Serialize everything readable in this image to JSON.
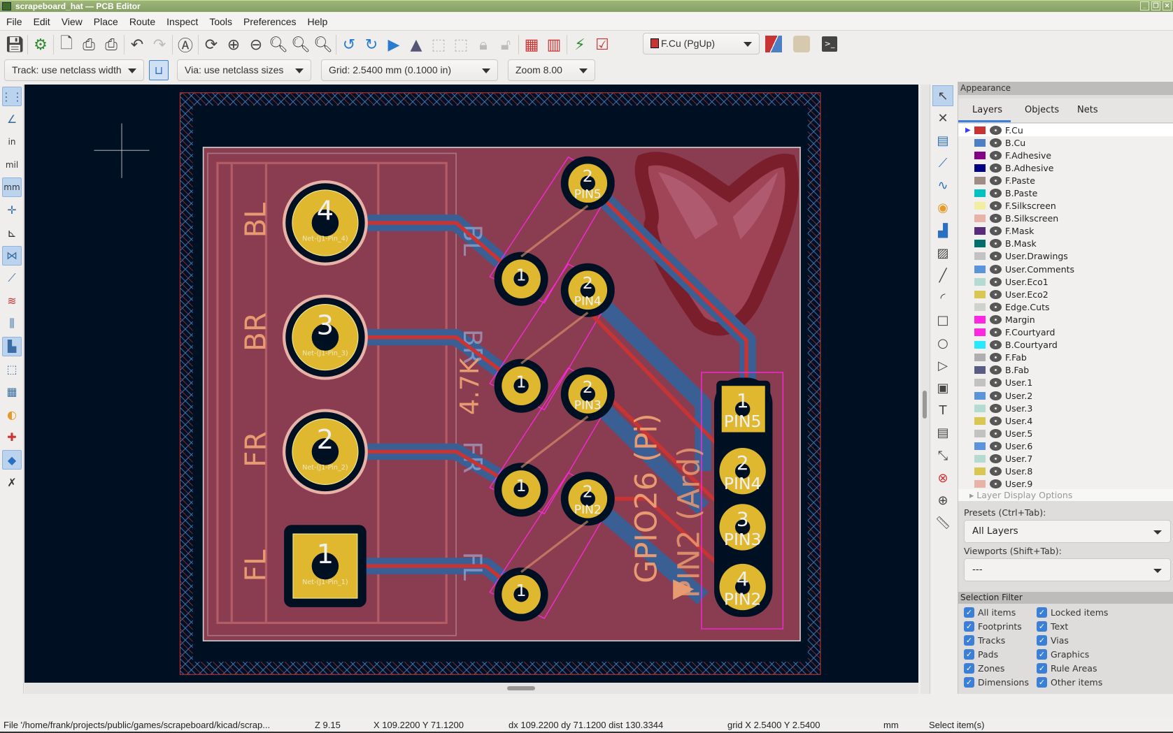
{
  "window": {
    "title": "scrapeboard_hat — PCB Editor",
    "controls": [
      "minimize",
      "restore",
      "close"
    ]
  },
  "menu": [
    "File",
    "Edit",
    "View",
    "Place",
    "Route",
    "Inspect",
    "Tools",
    "Preferences",
    "Help"
  ],
  "toolbar": {
    "layer_select": "F.Cu (PgUp)",
    "layer_color": "#c83434",
    "track_width": "Track: use netclass width",
    "via_size": "Via: use netclass sizes",
    "grid": "Grid: 2.5400 mm (0.1000 in)",
    "zoom": "Zoom 8.00"
  },
  "left_toolbar": {
    "units": {
      "in": "in",
      "mil": "mil",
      "mm": "mm"
    }
  },
  "board": {
    "large_pads": [
      {
        "num": "4",
        "net": "Net-(J1-Pin_4)"
      },
      {
        "num": "3",
        "net": "Net-(J1-Pin_3)"
      },
      {
        "num": "2",
        "net": "Net-(J1-Pin_2)"
      },
      {
        "num": "1",
        "net": "Net-(J1-Pin_1)"
      }
    ],
    "pad_labels": [
      "BL",
      "BR",
      "FR",
      "FL"
    ],
    "back_labels": [
      "BL",
      "BR",
      "FR",
      "FL"
    ],
    "resistor_value": "4.7K",
    "resistor_pins": [
      {
        "p1": "1",
        "p2": "2",
        "name": "PIN5"
      },
      {
        "p1": "1",
        "p2": "2",
        "name": "PIN4"
      },
      {
        "p1": "1",
        "p2": "2",
        "name": "PIN3"
      },
      {
        "p1": "1",
        "p2": "2",
        "name": "PIN2"
      }
    ],
    "connector_pins": [
      {
        "num": "1",
        "name": "PIN5"
      },
      {
        "num": "2",
        "name": "PIN4"
      },
      {
        "num": "3",
        "name": "PIN3"
      },
      {
        "num": "4",
        "name": "PIN2"
      }
    ],
    "silk_gpio": "GPIO26 (Pi)",
    "silk_ard": "PIN2 (Ard)",
    "colors": {
      "background": "#001023",
      "board": "#8a3d51",
      "front_copper": "#c83434",
      "back_copper": "#3a5f94",
      "pad": "#e0b830",
      "silkscreen": "#e89a70",
      "courtyard": "#ff26e2"
    }
  },
  "appearance": {
    "title": "Appearance",
    "tabs": [
      "Layers",
      "Objects",
      "Nets"
    ],
    "active_tab": "Layers",
    "layers": [
      {
        "name": "F.Cu",
        "color": "#c83434"
      },
      {
        "name": "B.Cu",
        "color": "#4d7fc4"
      },
      {
        "name": "F.Adhesive",
        "color": "#840084"
      },
      {
        "name": "B.Adhesive",
        "color": "#000084"
      },
      {
        "name": "F.Paste",
        "color": "#a08c86"
      },
      {
        "name": "B.Paste",
        "color": "#00c2c2"
      },
      {
        "name": "F.Silkscreen",
        "color": "#f2eda1"
      },
      {
        "name": "B.Silkscreen",
        "color": "#e8b2a7"
      },
      {
        "name": "F.Mask",
        "color": "#582c7a"
      },
      {
        "name": "B.Mask",
        "color": "#016e6e"
      },
      {
        "name": "User.Drawings",
        "color": "#c2c2c2"
      },
      {
        "name": "User.Comments",
        "color": "#5994dc"
      },
      {
        "name": "User.Eco1",
        "color": "#b4dbd2"
      },
      {
        "name": "User.Eco2",
        "color": "#d8c852"
      },
      {
        "name": "Edge.Cuts",
        "color": "#d0d2cd"
      },
      {
        "name": "Margin",
        "color": "#ff26e2"
      },
      {
        "name": "F.Courtyard",
        "color": "#ff26e2"
      },
      {
        "name": "B.Courtyard",
        "color": "#26e9ff"
      },
      {
        "name": "F.Fab",
        "color": "#afafaf"
      },
      {
        "name": "B.Fab",
        "color": "#585d84"
      },
      {
        "name": "User.1",
        "color": "#c2c2c2"
      },
      {
        "name": "User.2",
        "color": "#5994dc"
      },
      {
        "name": "User.3",
        "color": "#b4dbd2"
      },
      {
        "name": "User.4",
        "color": "#d8c852"
      },
      {
        "name": "User.5",
        "color": "#c2c2c2"
      },
      {
        "name": "User.6",
        "color": "#5994dc"
      },
      {
        "name": "User.7",
        "color": "#b4dbd2"
      },
      {
        "name": "User.8",
        "color": "#d8c852"
      },
      {
        "name": "User.9",
        "color": "#e8b2a7"
      }
    ],
    "active_layer": "F.Cu",
    "layer_display_options": "Layer Display Options",
    "presets_label": "Presets (Ctrl+Tab):",
    "presets_value": "All Layers",
    "viewports_label": "Viewports (Shift+Tab):",
    "viewports_value": "---"
  },
  "selection_filter": {
    "title": "Selection Filter",
    "items": [
      {
        "label": "All items",
        "checked": true
      },
      {
        "label": "Locked items",
        "checked": true
      },
      {
        "label": "Footprints",
        "checked": true
      },
      {
        "label": "Text",
        "checked": true
      },
      {
        "label": "Tracks",
        "checked": true
      },
      {
        "label": "Vias",
        "checked": true
      },
      {
        "label": "Pads",
        "checked": true
      },
      {
        "label": "Graphics",
        "checked": true
      },
      {
        "label": "Zones",
        "checked": true
      },
      {
        "label": "Rule Areas",
        "checked": true
      },
      {
        "label": "Dimensions",
        "checked": true
      },
      {
        "label": "Other items",
        "checked": true
      }
    ]
  },
  "status": {
    "file": "File '/home/frank/projects/public/games/scrapeboard/kicad/scrap...",
    "zoom": "Z 9.15",
    "cursor": "X 109.2200  Y 71.1200",
    "delta": "dx 109.2200  dy 71.1200  dist 130.3344",
    "grid": "grid X 2.5400  Y 2.5400",
    "units": "mm",
    "message": "Select item(s)"
  }
}
